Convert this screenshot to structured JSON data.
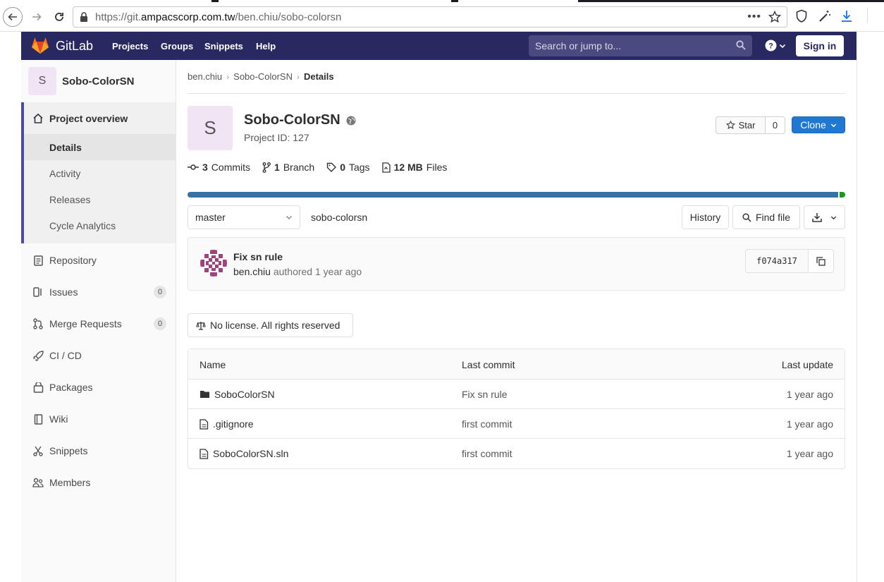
{
  "browser": {
    "url_prefix": "https://git.",
    "url_host": "ampacscorp.com.tw",
    "url_path": "/ben.chiu/sobo-colorsn",
    "more_label": "•••"
  },
  "header": {
    "brand": "GitLab",
    "nav": [
      "Projects",
      "Groups",
      "Snippets",
      "Help"
    ],
    "search_placeholder": "Search or jump to...",
    "sign_in": "Sign in"
  },
  "sidebar": {
    "avatar_letter": "S",
    "project_name": "Sobo-ColorSN",
    "overview_label": "Project overview",
    "sub_items": [
      "Details",
      "Activity",
      "Releases",
      "Cycle Analytics"
    ],
    "items": [
      {
        "label": "Repository",
        "icon": "doc-icon"
      },
      {
        "label": "Issues",
        "icon": "issues-icon",
        "count": "0"
      },
      {
        "label": "Merge Requests",
        "icon": "merge-request-icon",
        "count": "0"
      },
      {
        "label": "CI / CD",
        "icon": "rocket-icon"
      },
      {
        "label": "Packages",
        "icon": "package-icon"
      },
      {
        "label": "Wiki",
        "icon": "book-icon"
      },
      {
        "label": "Snippets",
        "icon": "scissors-icon"
      },
      {
        "label": "Members",
        "icon": "users-icon"
      }
    ]
  },
  "breadcrumb": {
    "items": [
      "ben.chiu",
      "Sobo-ColorSN",
      "Details"
    ],
    "separator": "›"
  },
  "project": {
    "avatar_letter": "S",
    "title": "Sobo-ColorSN",
    "id_text": "Project ID: 127",
    "star_label": "Star",
    "star_count": "0",
    "clone_label": "Clone",
    "stats": [
      {
        "value": "3",
        "label": "Commits"
      },
      {
        "value": "1",
        "label": "Branch"
      },
      {
        "value": "0",
        "label": "Tags"
      },
      {
        "value": "12 MB",
        "label": "Files"
      }
    ]
  },
  "languages": {
    "colors": [
      "#3672a4",
      "#1c9a1c"
    ]
  },
  "toolbar": {
    "branch": "master",
    "path": "sobo-colorsn",
    "history": "History",
    "find_file": "Find file"
  },
  "last_commit": {
    "title": "Fix sn rule",
    "author": "ben.chiu",
    "meta": "authored 1 year ago",
    "sha": "f074a317"
  },
  "license": {
    "label": "No license. All rights reserved"
  },
  "file_tree": {
    "headers": [
      "Name",
      "Last commit",
      "Last update"
    ],
    "rows": [
      {
        "name": "SoboColorSN",
        "type": "folder",
        "commit": "Fix sn rule",
        "updated": "1 year ago"
      },
      {
        "name": ".gitignore",
        "type": "file",
        "commit": "first commit",
        "updated": "1 year ago"
      },
      {
        "name": "SoboColorSN.sln",
        "type": "file",
        "commit": "first commit",
        "updated": "1 year ago"
      }
    ]
  },
  "colors": {
    "header_bg": "#292961",
    "primary": "#1f78d1",
    "sidebar_accent": "#4b4ba3",
    "avatar_bg": "#f0e4f5"
  }
}
